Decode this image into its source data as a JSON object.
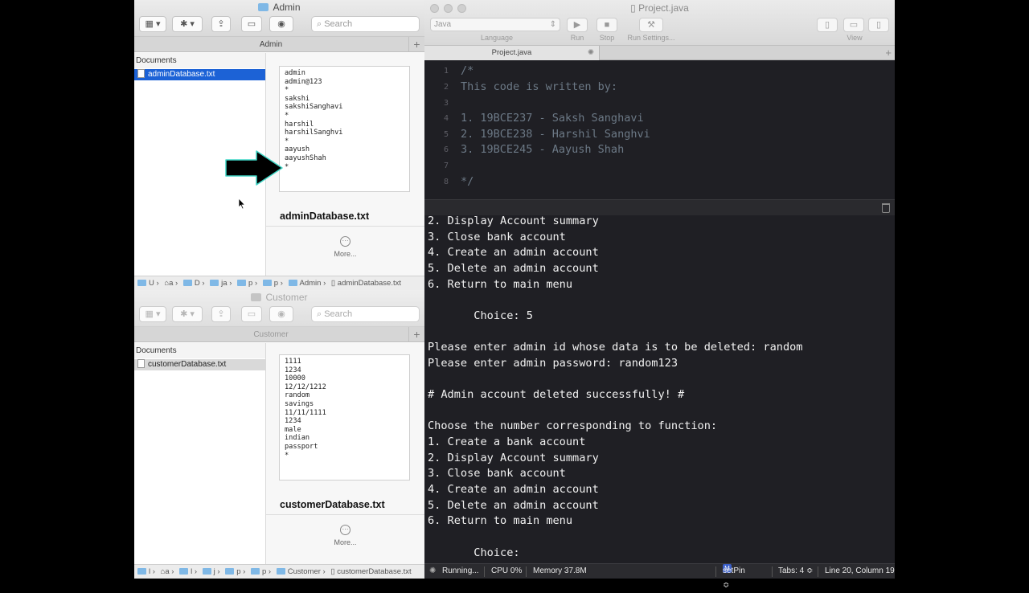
{
  "admin_window": {
    "title": "Admin",
    "tab_label": "Admin",
    "search_placeholder": "Search",
    "sidebar_heading": "Documents",
    "selected_file": "adminDatabase.txt",
    "preview_text": "admin\nadmin@123\n*\nsakshi\nsakshiSanghavi\n*\nharshil\nharshilSanghvi\n*\naayush\naayushShah\n*",
    "preview_filename": "adminDatabase.txt",
    "more_label": "More...",
    "path": [
      "U",
      "a",
      "D",
      "ja",
      "p",
      "p",
      "Admin",
      "adminDatabase.txt"
    ]
  },
  "customer_window": {
    "title": "Customer",
    "tab_label": "Customer",
    "search_placeholder": "Search",
    "sidebar_heading": "Documents",
    "selected_file": "customerDatabase.txt",
    "preview_text": "1111\n1234\n10000\n12/12/1212\nrandom\nsavings\n11/11/1111\n1234\nmale\nindian\npassport\n*",
    "preview_filename": "customerDatabase.txt",
    "more_label": "More...",
    "path": [
      "l",
      "a",
      "l",
      "j",
      "p",
      "p",
      "Customer",
      "customerDatabase.txt"
    ]
  },
  "editor": {
    "title": "Project.java",
    "language": "Java",
    "labels": {
      "language": "Language",
      "run": "Run",
      "stop": "Stop",
      "run_settings": "Run Settings...",
      "view": "View"
    },
    "tab": "Project.java",
    "code_lines": [
      {
        "n": "1",
        "text": "/*"
      },
      {
        "n": "2",
        "text": "This code is written by:"
      },
      {
        "n": "3",
        "text": ""
      },
      {
        "n": "4",
        "text": "1. 19BCE237 - Saksh Sanghavi"
      },
      {
        "n": "5",
        "text": "2. 19BCE238 - Harshil Sanghvi"
      },
      {
        "n": "6",
        "text": "3. 19BCE245 - Aayush Shah"
      },
      {
        "n": "7",
        "text": ""
      },
      {
        "n": "8",
        "text": "*/"
      }
    ],
    "console_lines": [
      "2. Display Account summary",
      "3. Close bank account",
      "4. Create an admin account",
      "5. Delete an admin account",
      "6. Return to main menu",
      "",
      "       Choice: 5",
      "",
      "Please enter admin id whose data is to be deleted: random",
      "Please enter admin password: random123",
      "",
      "# Admin account deleted successfully! #",
      "",
      "Choose the number corresponding to function:",
      "1. Create a bank account",
      "2. Display Account summary",
      "3. Close bank account",
      "4. Create an admin account",
      "5. Delete an admin account",
      "6. Return to main menu",
      "",
      "       Choice:"
    ],
    "status": {
      "running": "Running...",
      "cpu": "CPU 0%",
      "memory": "Memory 37.8M",
      "badge": "M",
      "method": "setPin ≎",
      "tabs": "Tabs: 4 ≎",
      "position": "Line 20, Column 19"
    }
  }
}
